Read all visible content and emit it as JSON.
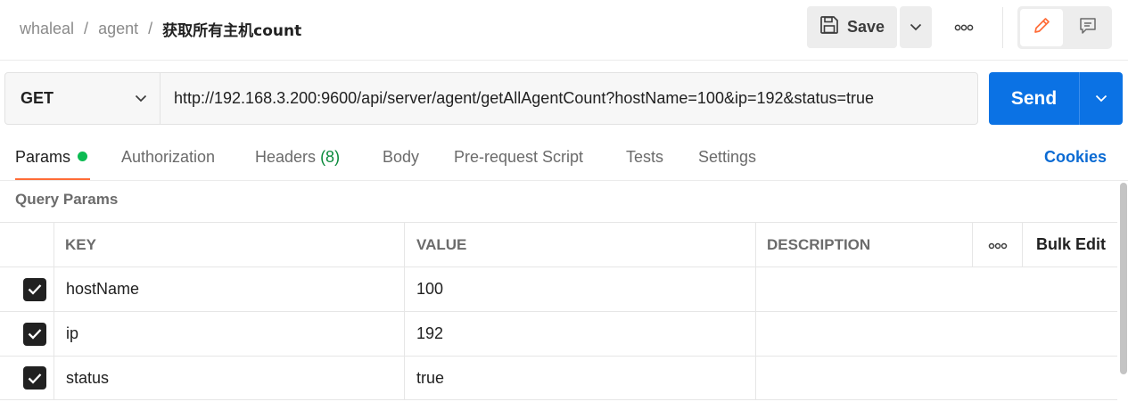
{
  "breadcrumb": {
    "workspace": "whaleal",
    "collection": "agent",
    "separator": "/",
    "request": "获取所有主机count"
  },
  "toolbar": {
    "save_label": "Save"
  },
  "request": {
    "method": "GET",
    "url": "http://192.168.3.200:9600/api/server/agent/getAllAgentCount?hostName=100&ip=192&status=true",
    "send_label": "Send"
  },
  "tabs": {
    "params": "Params",
    "authorization": "Authorization",
    "headers": "Headers",
    "headers_count": "(8)",
    "body": "Body",
    "prerequest": "Pre-request Script",
    "tests": "Tests",
    "settings": "Settings",
    "cookies": "Cookies"
  },
  "params": {
    "section_label": "Query Params",
    "columns": {
      "key": "KEY",
      "value": "VALUE",
      "description": "DESCRIPTION",
      "bulk_edit": "Bulk Edit"
    },
    "rows": [
      {
        "checked": true,
        "key": "hostName",
        "value": "100",
        "description": ""
      },
      {
        "checked": true,
        "key": "ip",
        "value": "192",
        "description": ""
      },
      {
        "checked": true,
        "key": "status",
        "value": "true",
        "description": ""
      }
    ]
  },
  "colors": {
    "accent_blue": "#0b72e4",
    "active_tab": "#ff6c37",
    "status_dot": "#0cbb52",
    "cookies_link": "#0b6bd3"
  },
  "icons": [
    "save-icon",
    "chevron-down-icon",
    "more-horizontal-icon",
    "pencil-icon",
    "comment-icon",
    "checkmark-icon"
  ]
}
